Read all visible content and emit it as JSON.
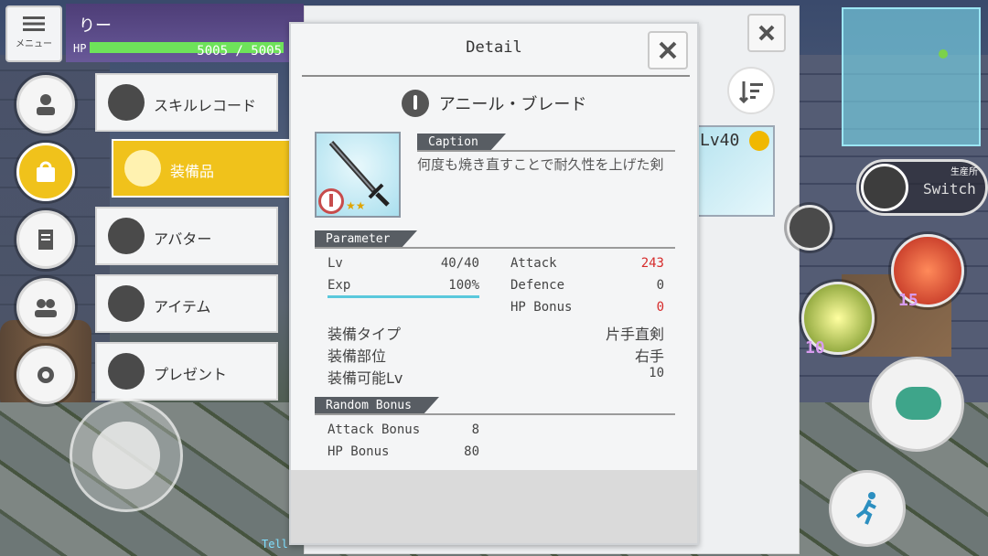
{
  "hud": {
    "menu_label": "メニュー",
    "player_name": "りー",
    "hp_label": "HP",
    "hp_text": "5005 / 5005",
    "hp_ratio": 1.0
  },
  "menu": {
    "items": [
      {
        "label": "スキルレコード",
        "icon": "skill-record-icon"
      },
      {
        "label": "装備品",
        "icon": "equipment-icon",
        "active": true
      },
      {
        "label": "アバター",
        "icon": "avatar-icon"
      },
      {
        "label": "アイテム",
        "icon": "item-icon"
      },
      {
        "label": "プレゼント",
        "icon": "present-icon"
      }
    ]
  },
  "background_panel": {
    "card_level": "Lv40"
  },
  "detail": {
    "title": "Detail",
    "item_name": "アニール・ブレード",
    "stars": "★★",
    "caption_tag": "Caption",
    "caption_text": "何度も焼き直すことで耐久性を上げた剣",
    "parameter_tag": "Parameter",
    "params_left": [
      {
        "label": "Lv",
        "value": "40/40"
      },
      {
        "label": "Exp",
        "value": "100%"
      }
    ],
    "params_right": [
      {
        "label": "Attack",
        "value": "243"
      },
      {
        "label": "Defence",
        "value": "0"
      },
      {
        "label": "HP Bonus",
        "value": "0"
      }
    ],
    "equip_rows": [
      {
        "label": "装備タイプ",
        "value": "片手直剣"
      },
      {
        "label": "装備部位",
        "value": "右手"
      },
      {
        "label": "装備可能Lv",
        "value": "10"
      }
    ],
    "random_bonus_tag": "Random Bonus",
    "random_bonus": [
      {
        "label": "Attack Bonus",
        "value": "8"
      },
      {
        "label": "HP Bonus",
        "value": "80"
      }
    ]
  },
  "right_hud": {
    "switch_sub": "生産所",
    "switch_label": "Switch",
    "skill_count_a": "15",
    "skill_count_b": "10"
  },
  "tell_label": "Tell",
  "colors": {
    "accent_yellow": "#f0c21b",
    "attack_red": "#d62b2b",
    "hp_green": "#6ee25a",
    "exp_cyan": "#5ac8dc"
  }
}
